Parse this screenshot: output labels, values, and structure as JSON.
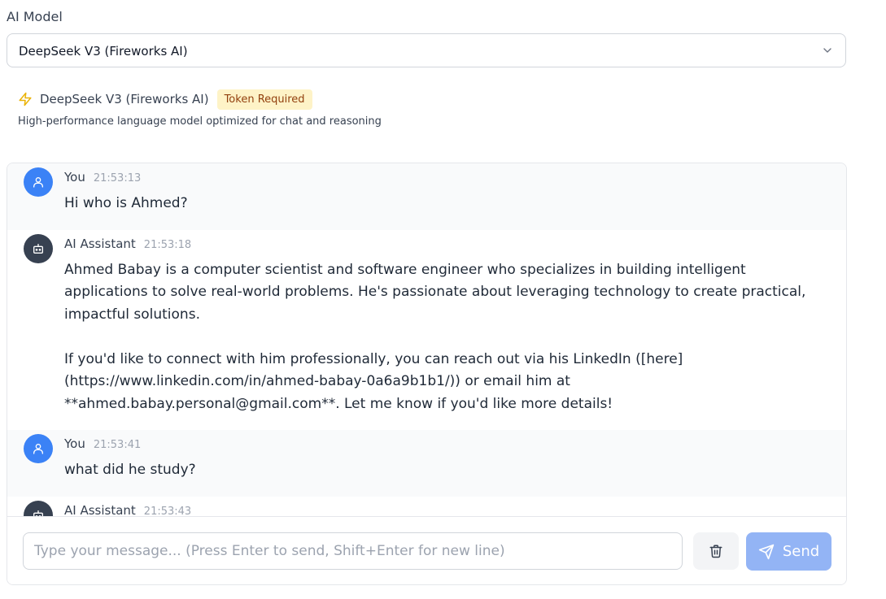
{
  "model_selector": {
    "label": "AI Model",
    "selected": "DeepSeek V3 (Fireworks AI)"
  },
  "model_info": {
    "name": "DeepSeek V3 (Fireworks AI)",
    "badge": "Token Required",
    "description": "High-performance language model optimized for chat and reasoning",
    "icon": "bolt-icon"
  },
  "messages": [
    {
      "role": "user",
      "sender": "You",
      "time": "21:53:13",
      "text": "Hi who is Ahmed?"
    },
    {
      "role": "ai",
      "sender": "AI Assistant",
      "time": "21:53:18",
      "text": "Ahmed Babay is a computer scientist and software engineer who specializes in building intelligent applications to solve real-world problems. He's passionate about leveraging technology to create practical, impactful solutions.\n\nIf you'd like to connect with him professionally, you can reach out via his LinkedIn ([here](https://www.linkedin.com/in/ahmed-babay-0a6a9b1b1/)) or email him at **ahmed.babay.personal@gmail.com**. Let me know if you'd like more details!"
    },
    {
      "role": "user",
      "sender": "You",
      "time": "21:53:41",
      "text": "what did he study?"
    },
    {
      "role": "ai",
      "sender": "AI Assistant",
      "time": "21:53:43",
      "text": ""
    }
  ],
  "composer": {
    "placeholder": "Type your message... (Press Enter to send, Shift+Enter for new line)",
    "value": "",
    "send_label": "Send"
  },
  "colors": {
    "user_avatar": "#3b82f6",
    "ai_avatar": "#374151",
    "badge_bg": "#fef3c7",
    "send_button": "#93b4f5"
  }
}
